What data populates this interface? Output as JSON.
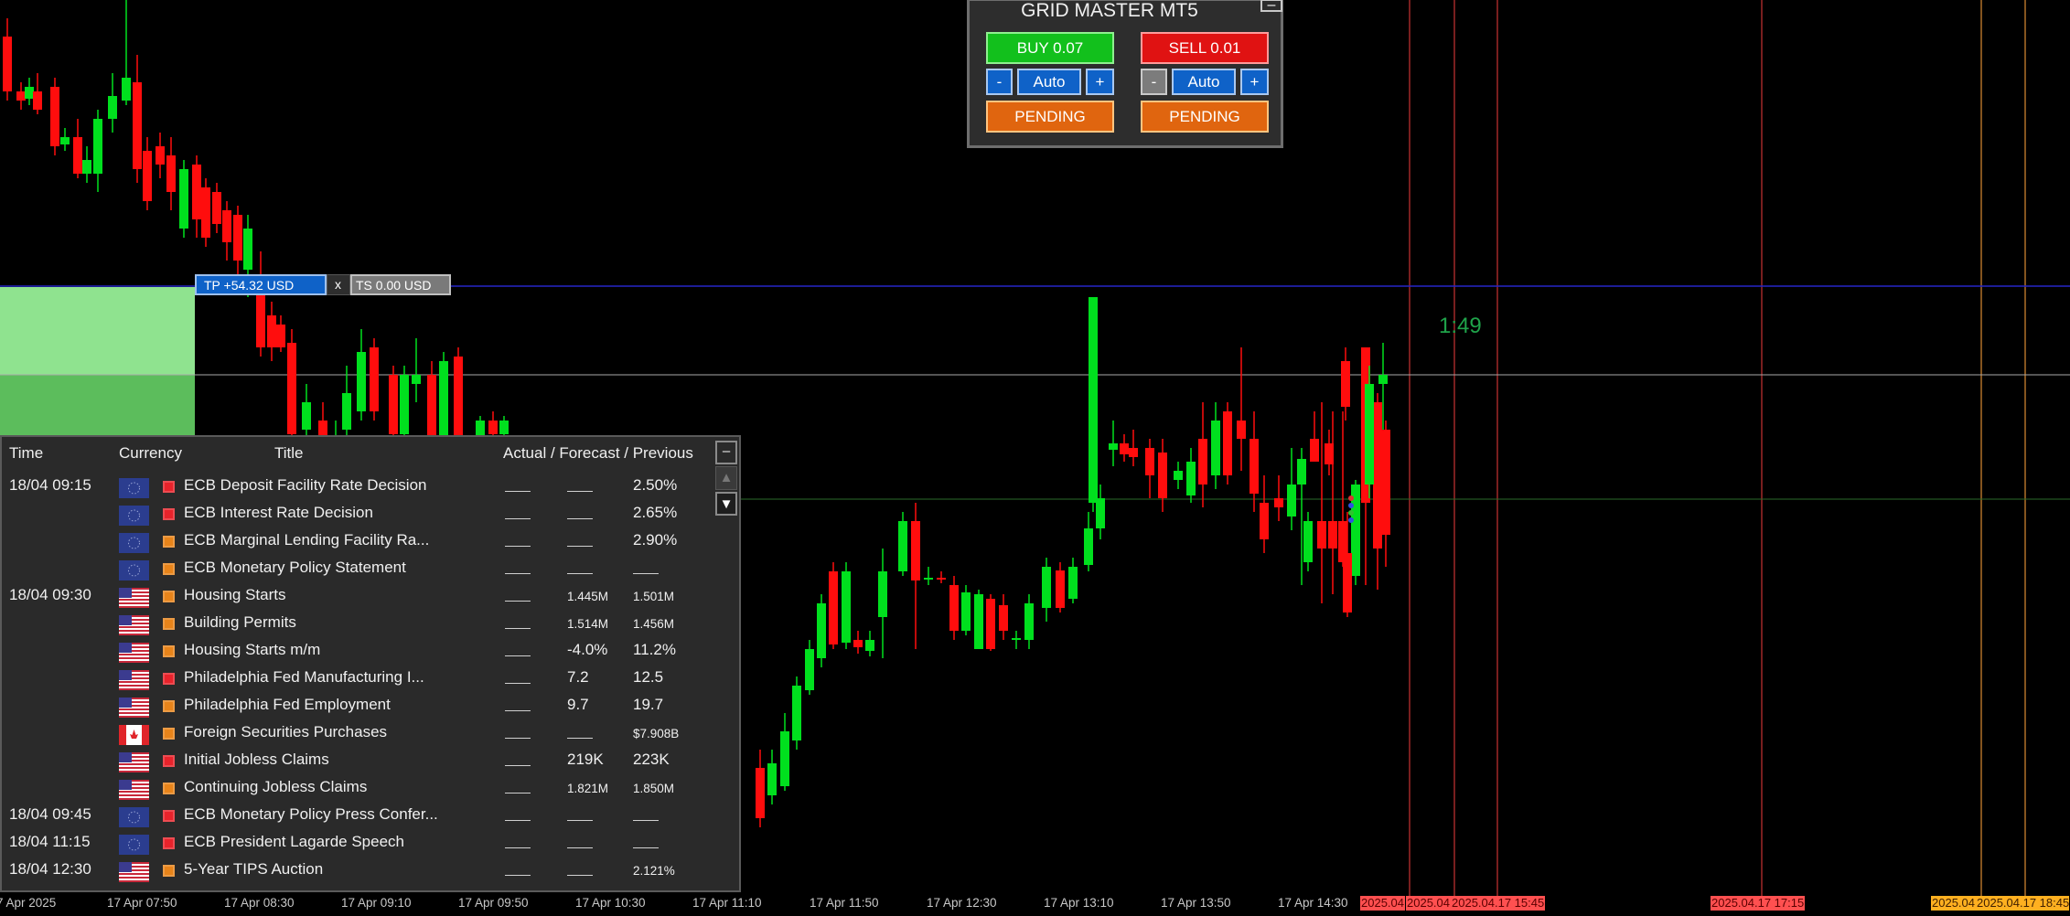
{
  "colors": {
    "bull": "#00e01e",
    "bear": "#ff0d0d",
    "tp_line": "#2525c8",
    "price_line": "#a8a8a8",
    "green_line": "#2a6a2a",
    "event_line_red": "#c83232",
    "event_line_orange": "#dc8c32",
    "timer_text": "#1fa34a"
  },
  "grid_master": {
    "title": "GRID MASTER MT5",
    "minimize_label": "–",
    "buy_label": "BUY 0.07",
    "sell_label": "SELL 0.01",
    "buy_minus": "-",
    "buy_auto": "Auto",
    "buy_plus": "+",
    "sell_minus": "-",
    "sell_auto": "Auto",
    "sell_plus": "+",
    "buy_pending": "PENDING",
    "sell_pending": "PENDING"
  },
  "trade_tags": {
    "tp_label": "TP +54.32 USD",
    "close_label": "x",
    "ts_label": "TS 0.00 USD"
  },
  "timer": "1:49",
  "news": {
    "headers": {
      "time": "Time",
      "currency": "Currency",
      "title": "Title",
      "values": "Actual / Forecast / Previous"
    },
    "scroll": {
      "minimize": "–",
      "up": "▲",
      "down": "▼"
    },
    "rows": [
      {
        "time": "18/04 09:15",
        "flag": "eu-flag-icon",
        "importance": "red",
        "title": "ECB Deposit Facility Rate Decision",
        "actual": "",
        "forecast": "",
        "previous": "2.50%"
      },
      {
        "time": "",
        "flag": "eu-flag-icon",
        "importance": "red",
        "title": "ECB Interest Rate Decision",
        "actual": "",
        "forecast": "",
        "previous": "2.65%"
      },
      {
        "time": "",
        "flag": "eu-flag-icon",
        "importance": "orange",
        "title": "ECB Marginal Lending Facility Ra...",
        "actual": "",
        "forecast": "",
        "previous": "2.90%"
      },
      {
        "time": "",
        "flag": "eu-flag-icon",
        "importance": "orange",
        "title": "ECB Monetary Policy Statement",
        "actual": "",
        "forecast": "",
        "previous": ""
      },
      {
        "time": "18/04 09:30",
        "flag": "us-flag-icon",
        "importance": "orange",
        "title": "Housing Starts",
        "actual": "",
        "forecast": "1.445M",
        "previous": "1.501M",
        "small": true
      },
      {
        "time": "",
        "flag": "us-flag-icon",
        "importance": "orange",
        "title": "Building Permits",
        "actual": "",
        "forecast": "1.514M",
        "previous": "1.456M",
        "small": true
      },
      {
        "time": "",
        "flag": "us-flag-icon",
        "importance": "orange",
        "title": "Housing Starts m/m",
        "actual": "",
        "forecast": "-4.0%",
        "previous": "11.2%"
      },
      {
        "time": "",
        "flag": "us-flag-icon",
        "importance": "red",
        "title": "Philadelphia Fed Manufacturing I...",
        "actual": "",
        "forecast": "7.2",
        "previous": "12.5"
      },
      {
        "time": "",
        "flag": "us-flag-icon",
        "importance": "orange",
        "title": "Philadelphia Fed Employment",
        "actual": "",
        "forecast": "9.7",
        "previous": "19.7"
      },
      {
        "time": "",
        "flag": "ca-flag-icon",
        "importance": "orange",
        "title": "Foreign Securities Purchases",
        "actual": "",
        "forecast": "",
        "previous": "$7.908B",
        "small": true
      },
      {
        "time": "",
        "flag": "us-flag-icon",
        "importance": "red",
        "title": "Initial Jobless Claims",
        "actual": "",
        "forecast": "219K",
        "previous": "223K"
      },
      {
        "time": "",
        "flag": "us-flag-icon",
        "importance": "orange",
        "title": "Continuing Jobless Claims",
        "actual": "",
        "forecast": "1.821M",
        "previous": "1.850M",
        "small": true
      },
      {
        "time": "18/04 09:45",
        "flag": "eu-flag-icon",
        "importance": "red",
        "title": "ECB Monetary Policy Press Confer...",
        "actual": "",
        "forecast": "",
        "previous": ""
      },
      {
        "time": "18/04 11:15",
        "flag": "eu-flag-icon",
        "importance": "red",
        "title": "ECB President Lagarde Speech",
        "actual": "",
        "forecast": "",
        "previous": ""
      },
      {
        "time": "18/04 12:30",
        "flag": "us-flag-icon",
        "importance": "orange",
        "title": "5-Year TIPS Auction",
        "actual": "",
        "forecast": "",
        "previous": "2.121%",
        "small": true
      }
    ]
  },
  "time_axis": {
    "labels": [
      "7 Apr 2025",
      "17 Apr 07:50",
      "17 Apr 08:30",
      "17 Apr 09:10",
      "17 Apr 09:50",
      "17 Apr 10:30",
      "17 Apr 11:10",
      "17 Apr 11:50",
      "17 Apr 12:30",
      "17 Apr 13:10",
      "17 Apr 13:50",
      "17 Apr 14:30"
    ],
    "event_labels": [
      {
        "text": "2025.04",
        "style": "red"
      },
      {
        "text": "2025.04",
        "style": "red"
      },
      {
        "text": "2025.04.17 15:45",
        "style": "red"
      },
      {
        "text": "2025.04.17 17:15",
        "style": "red"
      },
      {
        "text": "2025.04",
        "style": "orange"
      },
      {
        "text": "2025.04.17 18:45",
        "style": "orange"
      }
    ]
  }
}
